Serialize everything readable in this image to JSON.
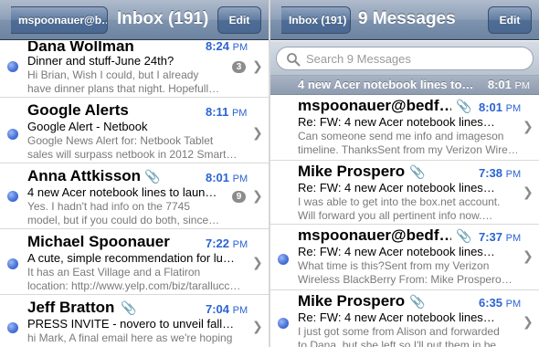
{
  "left": {
    "back_label": "mspoonauer@b…",
    "title": "Inbox (191)",
    "edit_label": "Edit",
    "messages": [
      {
        "sender": "Dana Wollman",
        "time": "8:24",
        "ampm": "PM",
        "subject": "Dinner and stuff-June 24th?",
        "preview1": "Hi Brian, Wish I could, but I already",
        "preview2": "have dinner plans that night. Hopefull…",
        "count": "3"
      },
      {
        "sender": "Google Alerts",
        "time": "8:11",
        "ampm": "PM",
        "subject": "Google Alert - Netbook",
        "preview1": "Google News Alert for: Netbook Tablet",
        "preview2": "sales will surpass netbook in 2012 Smart…"
      },
      {
        "sender": "Anna Attkisson",
        "time": "8:01",
        "ampm": "PM",
        "subject": "4 new Acer notebook lines to laun…",
        "preview1": "Yes. I hadn't had info on the 7745",
        "preview2": "model, but if you could do both, since…",
        "count": "9"
      },
      {
        "sender": "Michael Spoonauer",
        "time": "7:22",
        "ampm": "PM",
        "subject": "A cute, simple recommendation for lu…",
        "preview1": "It has an East Village and a Flatiron",
        "preview2": "location: http://www.yelp.com/biz/tarallucc…"
      },
      {
        "sender": "Jeff Bratton",
        "time": "7:04",
        "ampm": "PM",
        "subject": "PRESS INVITE - novero to unveil fall…",
        "preview1": "hi Mark, A final email here as we're hoping",
        "preview2": ""
      }
    ]
  },
  "right": {
    "back_label": "Inbox (191)",
    "title": "9 Messages",
    "edit_label": "Edit",
    "search_placeholder": "Search 9 Messages",
    "thread_subject": "4 new Acer notebook lines to…",
    "thread_time": "8:01",
    "thread_ampm": "PM",
    "messages": [
      {
        "sender": "mspoonauer@bedf…",
        "time": "8:01",
        "ampm": "PM",
        "subject": "Re: FW: 4 new Acer notebook lines…",
        "preview1": "Can someone send me info and imageson",
        "preview2": "timeline. ThanksSent from my Verizon Wire…"
      },
      {
        "sender": "Mike Prospero",
        "time": "7:38",
        "ampm": "PM",
        "subject": "Re: FW: 4 new Acer notebook lines…",
        "preview1": "I was able to get into the box.net account.",
        "preview2": "Will forward you all pertinent info now.…"
      },
      {
        "sender": "mspoonauer@bedf…",
        "time": "7:37",
        "ampm": "PM",
        "subject": "Re: FW: 4 new Acer notebook lines…",
        "preview1": "What time is this?Sent from my Verizon",
        "preview2": "Wireless BlackBerry From: Mike Prospero…"
      },
      {
        "sender": "Mike Prospero",
        "time": "6:35",
        "ampm": "PM",
        "subject": "Re: FW: 4 new Acer notebook lines…",
        "preview1": "I just got some from Alison and forwarded",
        "preview2": "to Dana, but she left so I'll put them in be"
      }
    ]
  },
  "colors": {
    "accent_blue": "#2a63d4",
    "unread_dot": "#4a74d9",
    "nav_bar": "#7d93ae"
  }
}
